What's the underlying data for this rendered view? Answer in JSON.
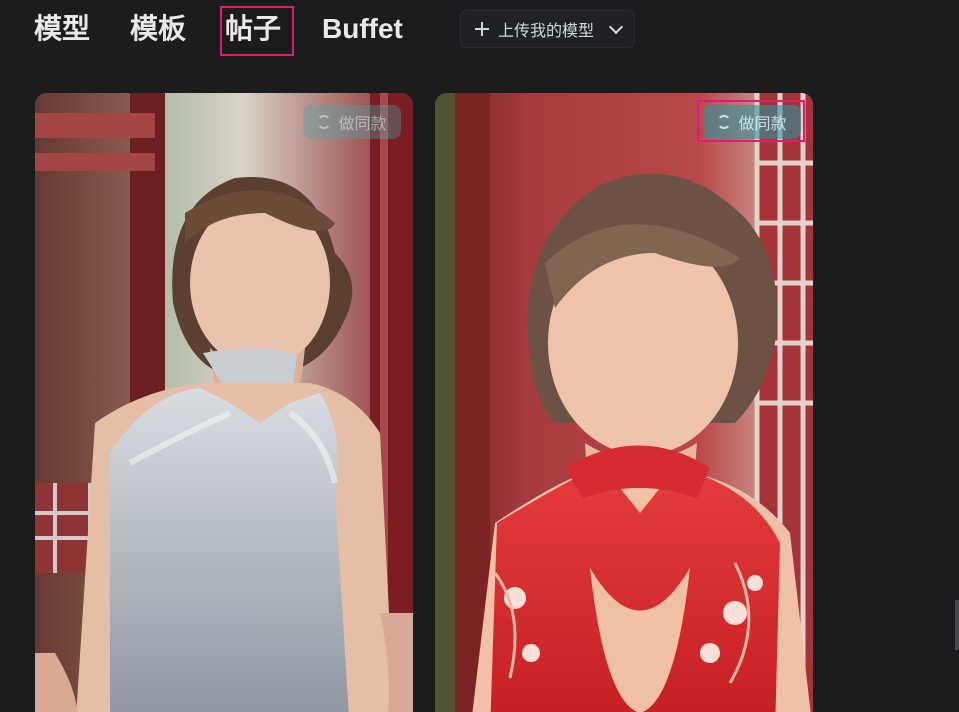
{
  "tabs": {
    "models": "模型",
    "templates": "模板",
    "posts": "帖子",
    "buffet": "Buffet"
  },
  "upload": {
    "label": "上传我的模型",
    "icon": "plus-icon",
    "dropdown_icon": "chevron-down-icon"
  },
  "cards": [
    {
      "button_label": "做同款",
      "icon": "refresh-icon"
    },
    {
      "button_label": "做同款",
      "icon": "refresh-icon"
    }
  ],
  "colors": {
    "background": "#1b1c1e",
    "highlight": "#e01b72",
    "button_teal": "#2a96a0"
  }
}
